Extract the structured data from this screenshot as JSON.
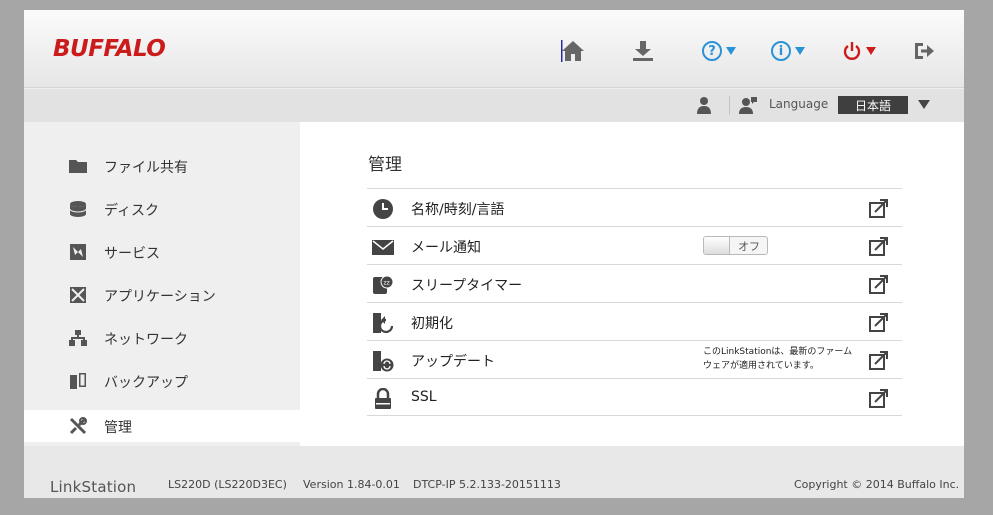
{
  "brand": {
    "logo": "BUFFALO",
    "product": "LinkStation"
  },
  "topbar": {
    "icons": [
      "home-icon",
      "download-icon",
      "help-icon",
      "info-icon",
      "power-icon",
      "logout-icon"
    ],
    "help_glyph": "?",
    "info_glyph": "i",
    "accent": "#2a93d8",
    "brand_color": "#cc1b1b"
  },
  "subbar": {
    "language_label": "Language",
    "language_value": "日本語"
  },
  "sidebar": {
    "items": [
      {
        "label": "ファイル共有",
        "icon": "folder-icon"
      },
      {
        "label": "ディスク",
        "icon": "disk-icon"
      },
      {
        "label": "サービス",
        "icon": "service-icon"
      },
      {
        "label": "アプリケーション",
        "icon": "application-icon"
      },
      {
        "label": "ネットワーク",
        "icon": "network-icon"
      },
      {
        "label": "バックアップ",
        "icon": "backup-icon"
      },
      {
        "label": "管理",
        "icon": "tools-icon",
        "active": true
      }
    ]
  },
  "main": {
    "title": "管理",
    "rows": [
      {
        "label": "名称/時刻/言語",
        "icon": "clock-icon"
      },
      {
        "label": "メール通知",
        "icon": "mail-icon",
        "toggle_label": "オフ"
      },
      {
        "label": "スリープタイマー",
        "icon": "sleep-timer-icon"
      },
      {
        "label": "初期化",
        "icon": "reset-icon"
      },
      {
        "label": "アップデート",
        "icon": "update-icon",
        "note_line1": "このLinkStationは、最新のファーム",
        "note_line2": "ウェアが適用されています。"
      },
      {
        "label": "SSL",
        "icon": "lock-icon"
      }
    ]
  },
  "footer": {
    "model": "LS220D (LS220D3EC)",
    "version": "Version 1.84-0.01",
    "dtcp": "DTCP-IP 5.2.133-20151113",
    "copyright": "Copyright © 2014 Buffalo Inc."
  }
}
